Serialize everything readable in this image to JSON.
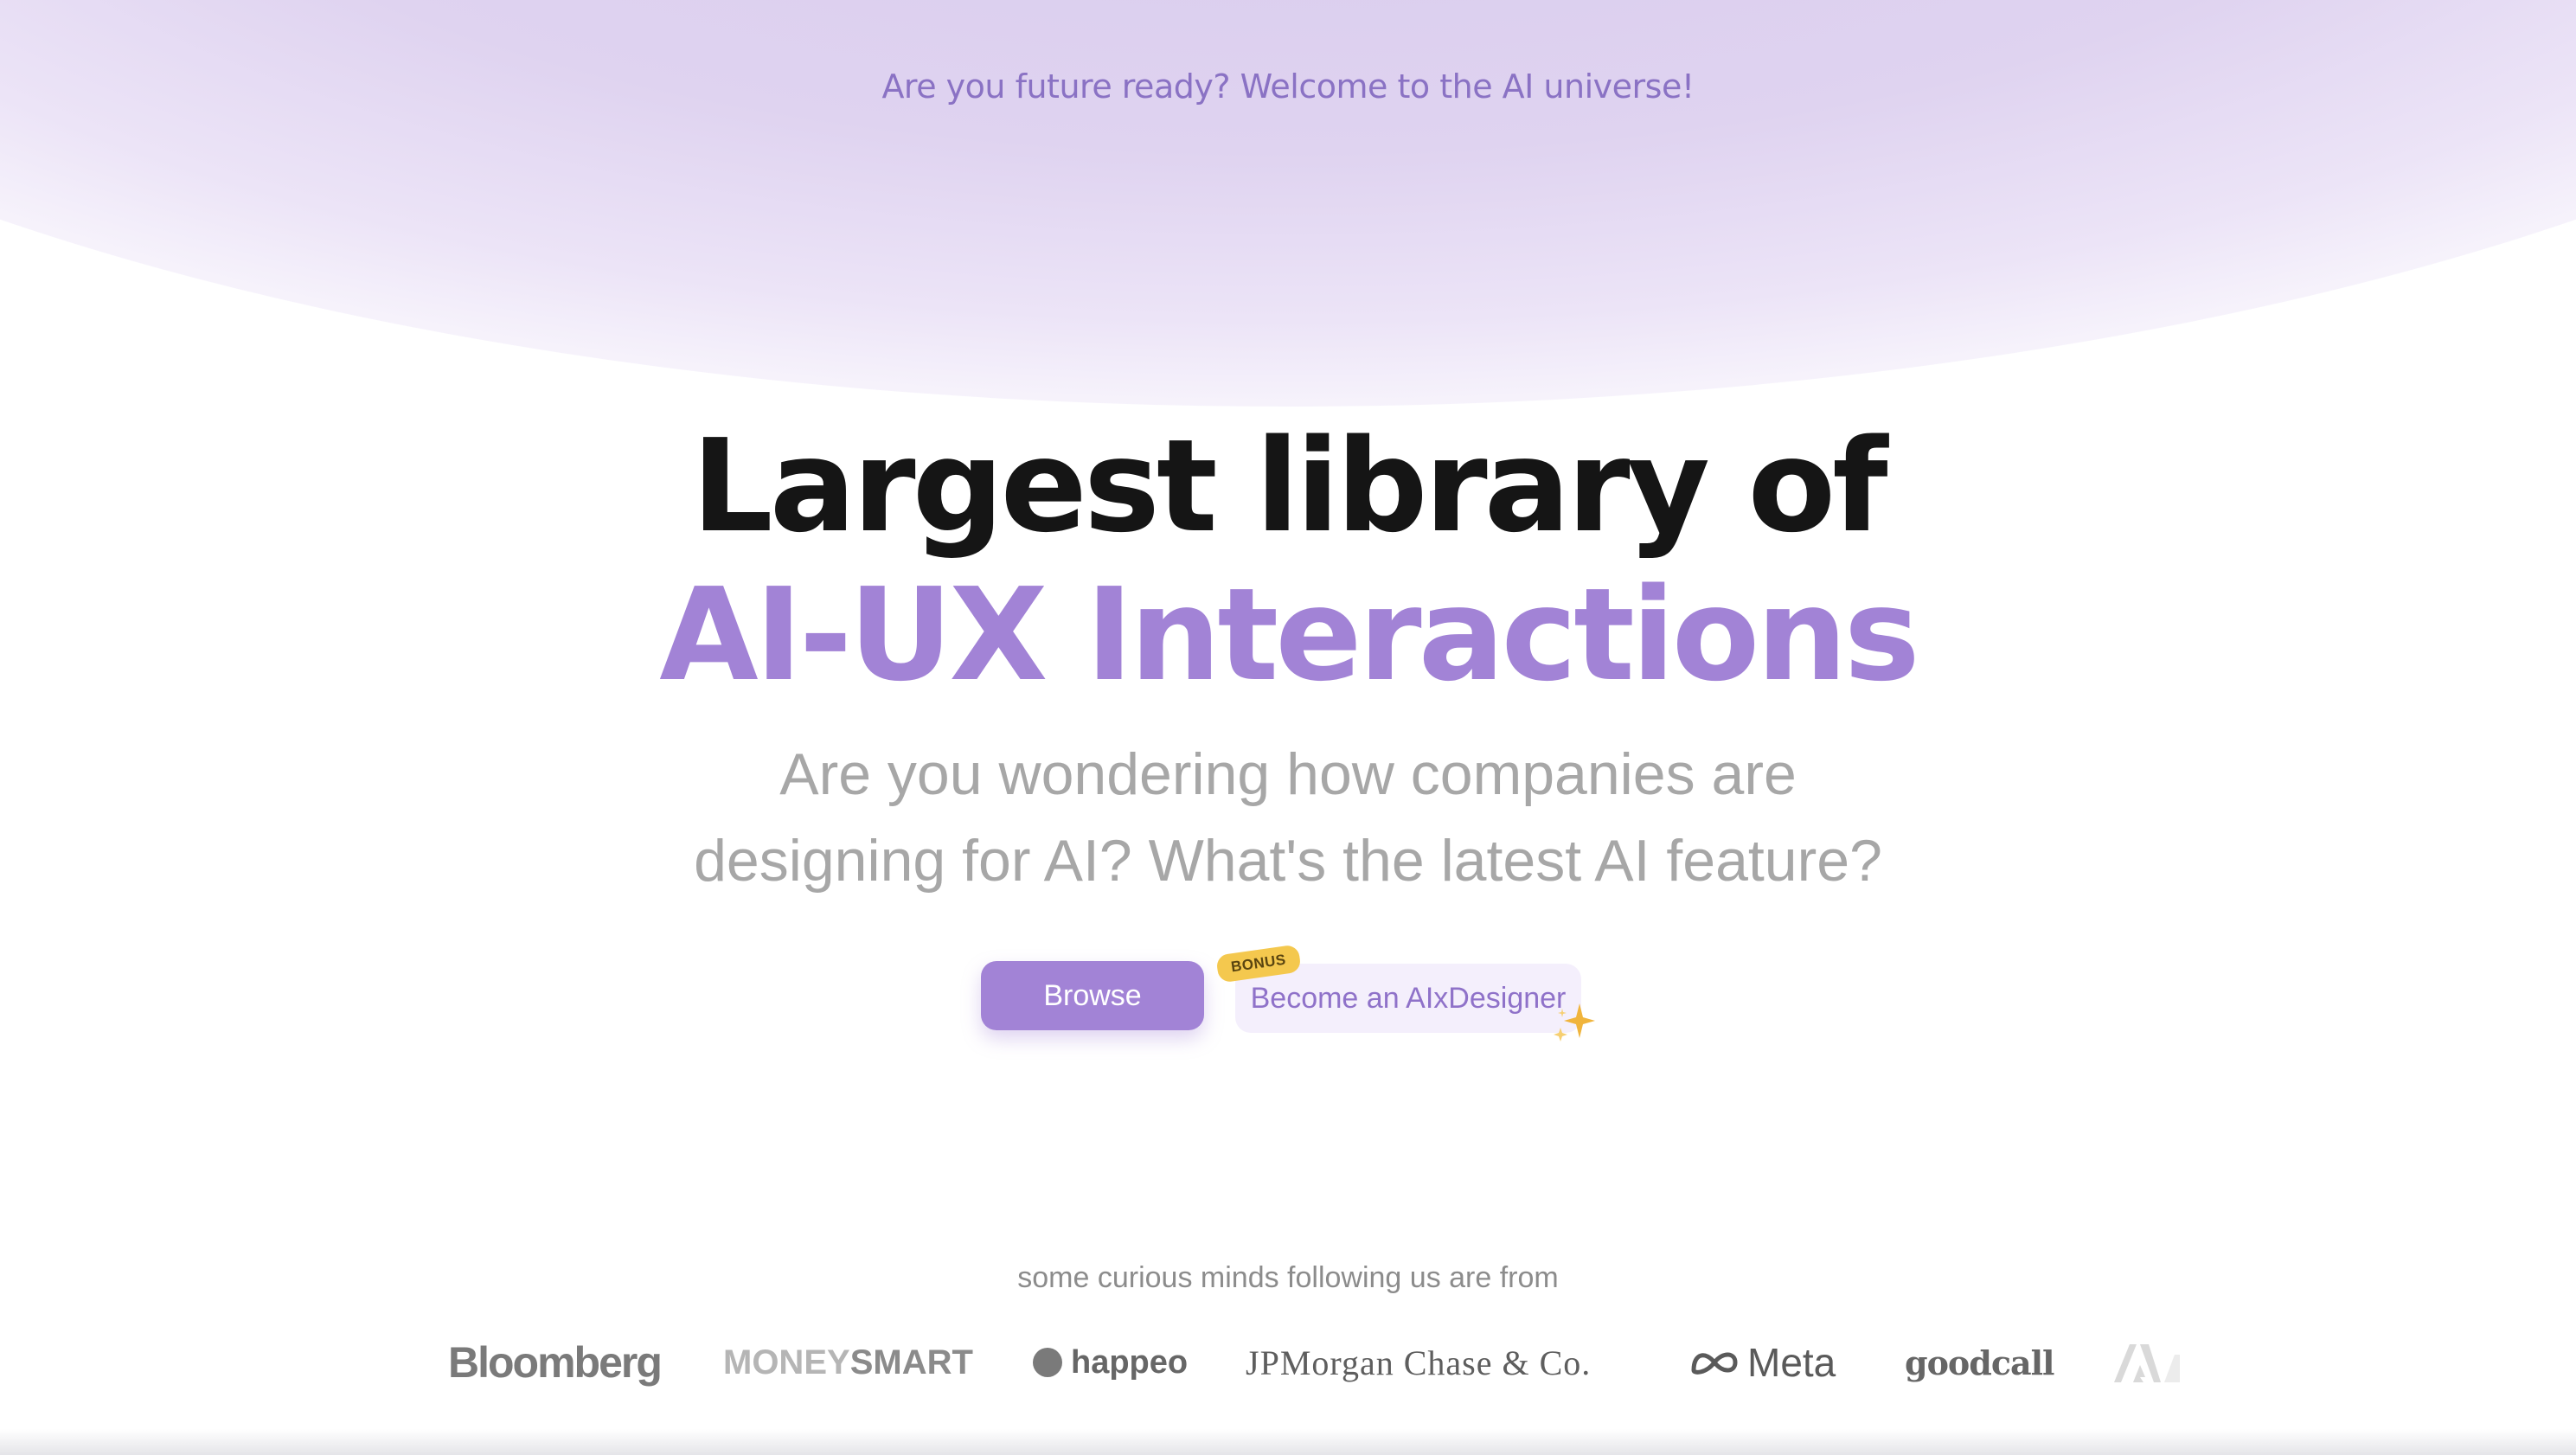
{
  "announcement": "Are you future ready? Welcome to the AI universe!",
  "hero": {
    "headline_line1": "Largest library of",
    "headline_line2": "AI-UX Interactions",
    "subtitle_line1": "Are you wondering how companies are",
    "subtitle_line2": "designing for AI? What's the latest AI feature?"
  },
  "cta": {
    "browse_label": "Browse",
    "designer_label": "Become an AIxDesigner",
    "bonus_badge": "BONUS"
  },
  "social_proof": {
    "caption": "some curious minds following us are from",
    "logos": {
      "bloomberg": "Bloomberg",
      "moneysmart_a": "MONEY",
      "moneysmart_b": "SMART",
      "happeo": "happeo",
      "jpmorgan": "JPMorgan Chase & Co.",
      "meta": "Meta",
      "goodcall": "goodcall"
    }
  },
  "colors": {
    "accent": "#a283d6",
    "announcement": "#8a72c4",
    "headline": "#151515",
    "subtitle": "#a7a7a7",
    "bonus": "#f4c84e",
    "sparkle": "#f0b43c"
  },
  "icons": {
    "sparkle": "sparkle-icon",
    "meta": "meta-infinity-icon",
    "happeo": "happeo-leaf-icon",
    "adobe": "adobe-icon"
  }
}
